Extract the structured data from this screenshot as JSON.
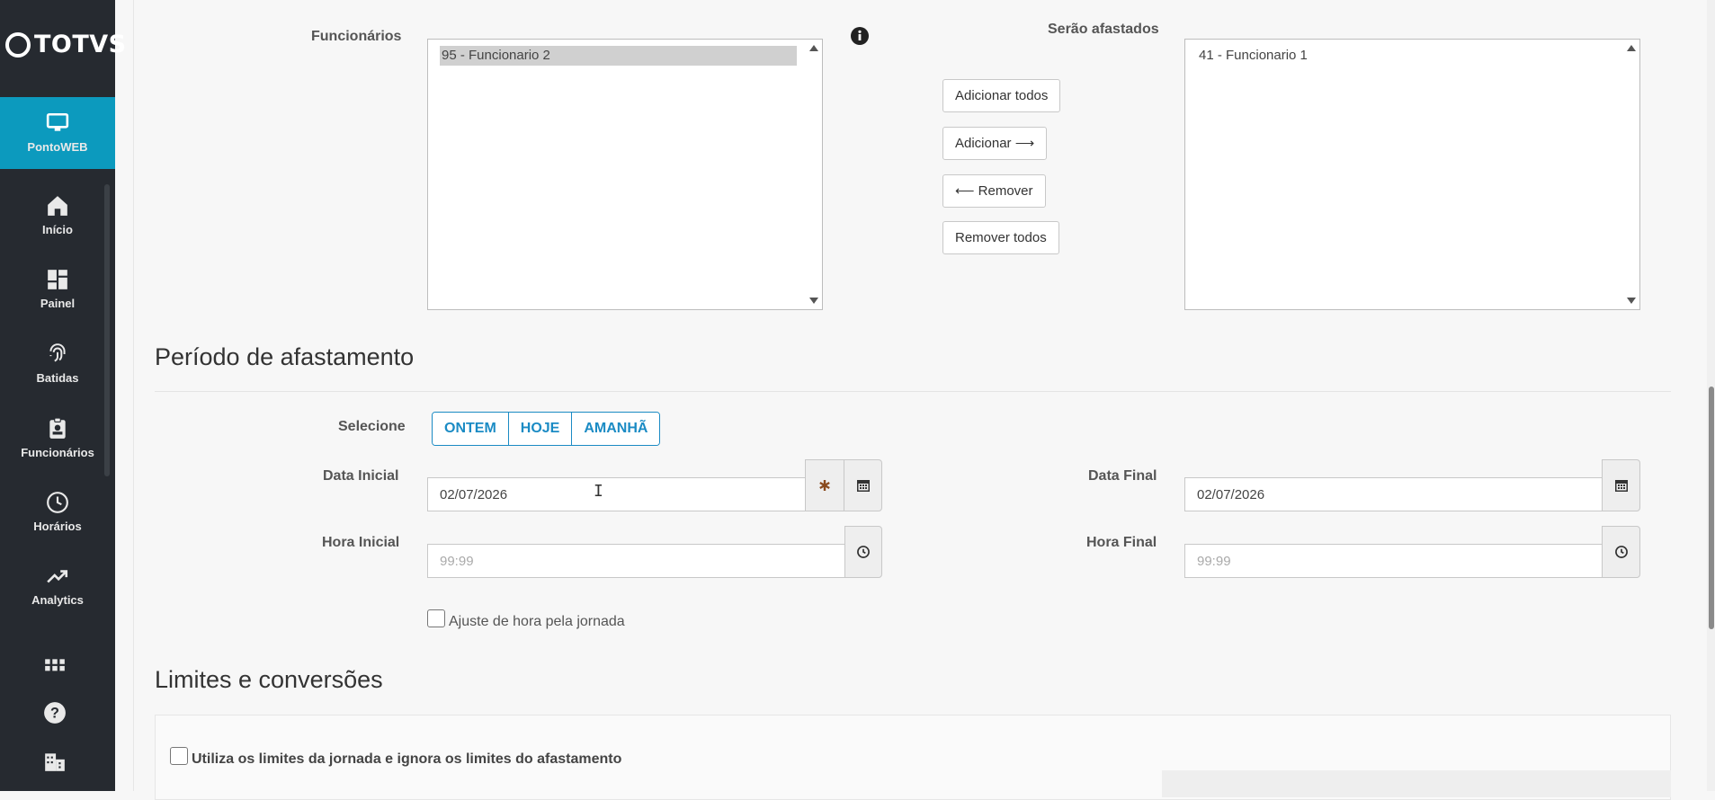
{
  "brand": {
    "name": "TOTVS"
  },
  "sidebar": {
    "active": {
      "label": "PontoWEB",
      "icon": "monitor-icon"
    },
    "items": [
      {
        "label": "Início",
        "icon": "home-icon"
      },
      {
        "label": "Painel",
        "icon": "dashboard-icon"
      },
      {
        "label": "Batidas",
        "icon": "fingerprint-icon"
      },
      {
        "label": "Funcionários",
        "icon": "badge-icon"
      },
      {
        "label": "Horários",
        "icon": "clock-icon"
      },
      {
        "label": "Analytics",
        "icon": "trend-icon"
      }
    ],
    "bottom_icons": [
      "apps-grid-icon",
      "help-icon",
      "building-icon"
    ]
  },
  "employees": {
    "label": "Funcionários",
    "available": [
      "95 - Funcionario 2"
    ],
    "selected_label": "Serão afastados",
    "selected": [
      "41 - Funcionario 1"
    ],
    "buttons": {
      "add_all": "Adicionar todos",
      "add": "Adicionar ⟶",
      "remove": "⟵ Remover",
      "remove_all": "Remover todos"
    }
  },
  "period": {
    "title": "Período de afastamento",
    "select_label": "Selecione",
    "quick_buttons": [
      "ONTEM",
      "HOJE",
      "AMANHÃ"
    ],
    "start_date_label": "Data Inicial",
    "start_date_value": "02/07/2026",
    "end_date_label": "Data Final",
    "end_date_value": "02/07/2026",
    "start_time_label": "Hora Inicial",
    "start_time_placeholder": "99:99",
    "end_time_label": "Hora Final",
    "end_time_placeholder": "99:99",
    "adjust_checkbox_label": "Ajuste de hora pela jornada"
  },
  "limits": {
    "title": "Limites e conversões",
    "use_journey_limits_label": "Utiliza os limites da jornada e ignora os limites do afastamento"
  },
  "colors": {
    "sidebar_bg": "#262a30",
    "active_bg": "#0c9abe",
    "accent": "#1b8bc4",
    "asterisk": "#8a4a1e"
  }
}
